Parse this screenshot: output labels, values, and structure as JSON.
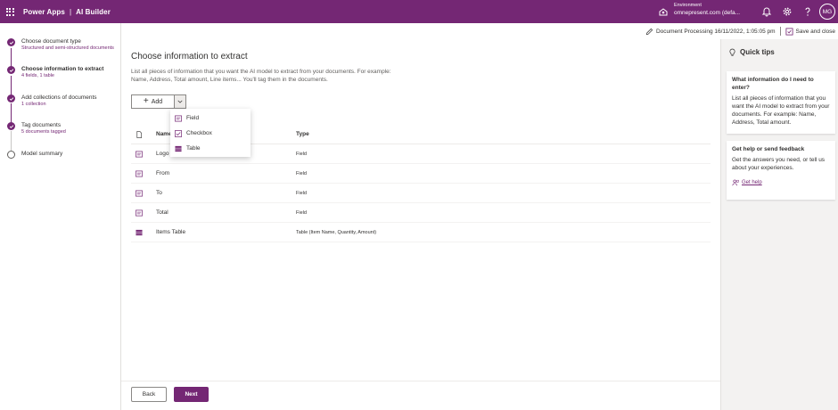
{
  "topbar": {
    "app_name": "Power Apps",
    "separator": "|",
    "product": "AI Builder",
    "environment_label": "Environment",
    "environment_value": "omnepresent.com (defa...",
    "user_initials": "MG",
    "icons": [
      "waffle-icon",
      "environment-icon",
      "bell-icon",
      "gear-icon",
      "help-icon"
    ]
  },
  "subheader": {
    "document_label": "Document Processing 16/11/2022, 1:05:05 pm",
    "save_close_label": "Save and close"
  },
  "steps": [
    {
      "title": "Choose document type",
      "subtitle": "Structured and semi-structured documents",
      "state": "done"
    },
    {
      "title": "Choose information to extract",
      "subtitle": "4 fields, 1 table",
      "state": "active"
    },
    {
      "title": "Add collections of documents",
      "subtitle": "1 collection",
      "state": "done"
    },
    {
      "title": "Tag documents",
      "subtitle": "5 documents tagged",
      "state": "done"
    },
    {
      "title": "Model summary",
      "subtitle": "",
      "state": "pending"
    }
  ],
  "main": {
    "title": "Choose information to extract",
    "description": "List all pieces of information that you want the AI model to extract from your documents. For example: Name, Address, Total amount, Line items... You'll tag them in the documents.",
    "add_label": "Add",
    "dropdown": [
      {
        "label": "Field",
        "icon": "field-icon"
      },
      {
        "label": "Checkbox",
        "icon": "checkbox-icon"
      },
      {
        "label": "Table",
        "icon": "table-icon"
      }
    ],
    "table": {
      "col_name": "Name",
      "col_type": "Type",
      "rows": [
        {
          "name": "Logo",
          "type": "Field",
          "icon": "field-icon"
        },
        {
          "name": "From",
          "type": "Field",
          "icon": "field-icon"
        },
        {
          "name": "To",
          "type": "Field",
          "icon": "field-icon"
        },
        {
          "name": "Total",
          "type": "Field",
          "icon": "field-icon"
        },
        {
          "name": "Items Table",
          "type": "Table (Item Name, Quantity, Amount)",
          "icon": "table-icon"
        }
      ]
    },
    "back_label": "Back",
    "next_label": "Next"
  },
  "quick_tips": {
    "title": "Quick tips",
    "card1_title": "What information do I need to enter?",
    "card1_body": "List all pieces of information that you want the AI model to extract from your documents. For example: Name, Address, Total amount.",
    "card2_title": "Get help or send feedback",
    "card2_body": "Get the answers you need, or tell us about your experiences.",
    "card2_link": "Get help"
  },
  "colors": {
    "brand": "#742774",
    "panel_bg": "#f3f2f1"
  }
}
